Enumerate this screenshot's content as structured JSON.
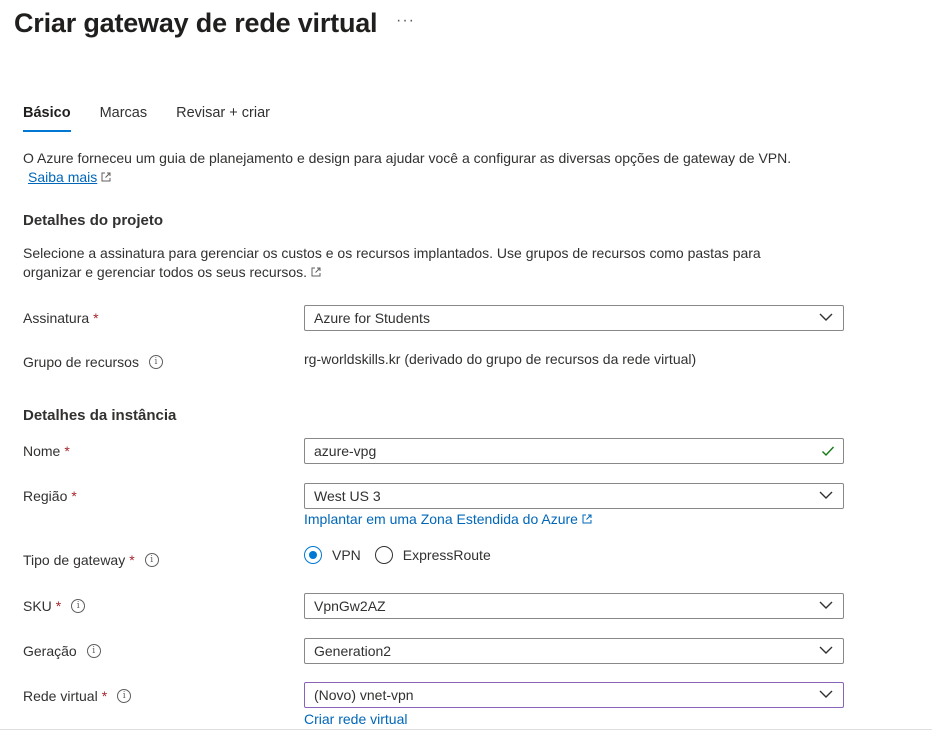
{
  "header": {
    "title": "Criar gateway de rede virtual",
    "more": "···"
  },
  "tabs": [
    {
      "label": "Básico",
      "active": true
    },
    {
      "label": "Marcas",
      "active": false
    },
    {
      "label": "Revisar + criar",
      "active": false
    }
  ],
  "intro": {
    "text": "O Azure forneceu um guia de planejamento e design para ajudar você a configurar as diversas opções de gateway de VPN.",
    "link": "Saiba mais"
  },
  "project": {
    "heading": "Detalhes do projeto",
    "description_line1": "Selecione a assinatura para gerenciar os custos e os recursos implantados. Use grupos de recursos como pastas para",
    "description_line2": "organizar e gerenciar todos os seus recursos.",
    "subscription": {
      "label": "Assinatura",
      "required": "*",
      "value": "Azure for Students"
    },
    "resource_group": {
      "label": "Grupo de recursos",
      "value": "rg-worldskills.kr (derivado do grupo de recursos da rede virtual)"
    }
  },
  "instance": {
    "heading": "Detalhes da instância",
    "name": {
      "label": "Nome",
      "required": "*",
      "value": "azure-vpg"
    },
    "region": {
      "label": "Região",
      "required": "*",
      "value": "West US 3",
      "link": "Implantar em uma Zona Estendida do Azure"
    },
    "gateway_type": {
      "label": "Tipo de gateway",
      "required": "*",
      "options": [
        "VPN",
        "ExpressRoute"
      ],
      "selected": "VPN"
    },
    "sku": {
      "label": "SKU",
      "required": "*",
      "value": "VpnGw2AZ"
    },
    "generation": {
      "label": "Geração",
      "value": "Generation2"
    },
    "vnet": {
      "label": "Rede virtual",
      "required": "*",
      "value": "(Novo) vnet-vpn",
      "link": "Criar rede virtual"
    }
  },
  "icons": {
    "info": "info-icon",
    "chevron": "chevron-down-icon",
    "check": "checkmark-icon",
    "external": "external-link-icon"
  },
  "colors": {
    "accent": "#0078d4",
    "link": "#0067b8",
    "required": "#a4262c",
    "valid": "#107c10",
    "focus_border": "#8764b8"
  }
}
